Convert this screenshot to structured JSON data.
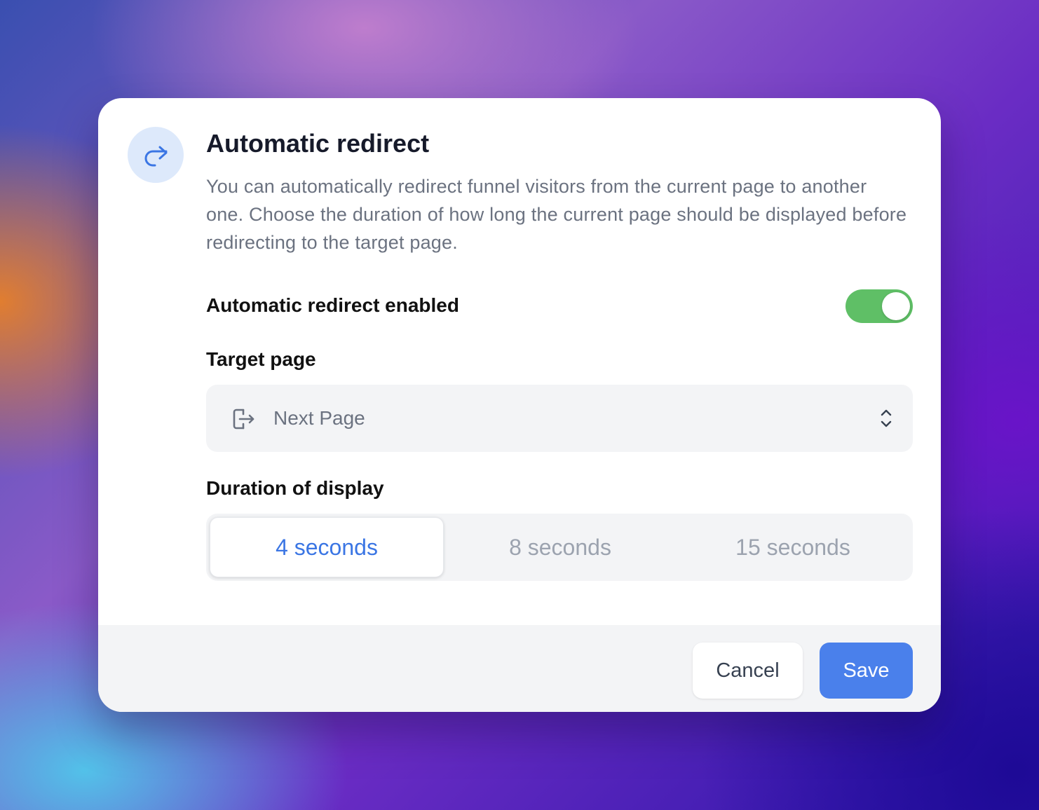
{
  "dialog": {
    "title": "Automatic redirect",
    "description": "You can automatically redirect funnel visitors from the current page to another one. Choose the duration of how long the current page should be displayed before redirecting to the target page.",
    "icon": "redirect-arrow-icon"
  },
  "toggle": {
    "label": "Automatic redirect enabled",
    "enabled": true,
    "color": "#5fbf66"
  },
  "target": {
    "label": "Target page",
    "value": "Next Page",
    "icon": "exit-page-icon"
  },
  "duration": {
    "label": "Duration of display",
    "options": [
      {
        "label": "4 seconds",
        "selected": true
      },
      {
        "label": "8 seconds",
        "selected": false
      },
      {
        "label": "15 seconds",
        "selected": false
      }
    ]
  },
  "footer": {
    "cancel_label": "Cancel",
    "save_label": "Save"
  },
  "colors": {
    "accent": "#4a80eb",
    "selected_text": "#3b76e4"
  }
}
